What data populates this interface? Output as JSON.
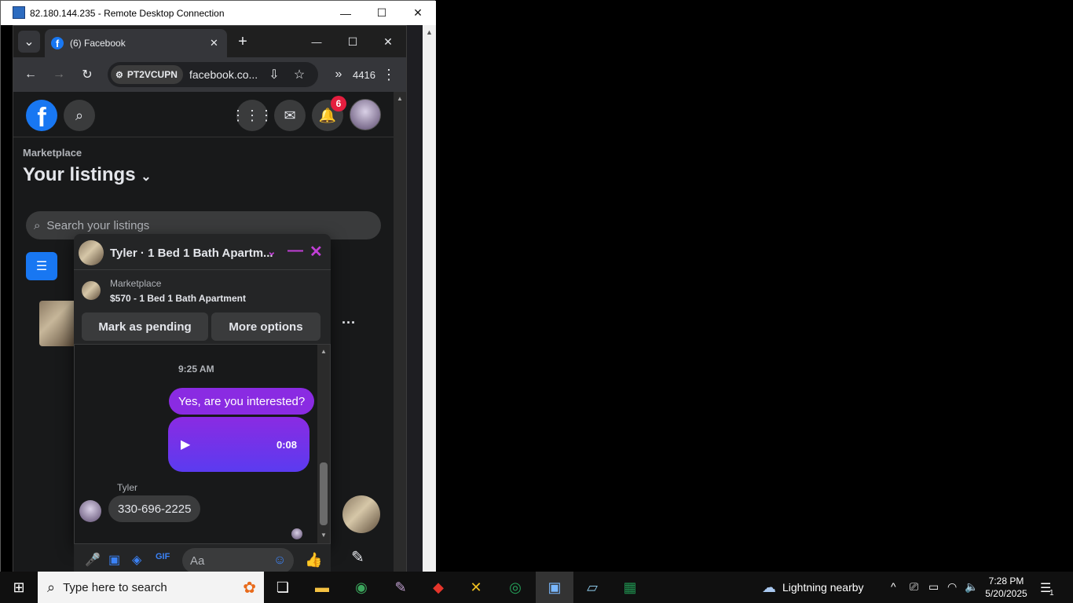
{
  "rdp": {
    "title": "82.180.144.235 - Remote Desktop Connection",
    "minimize": "—",
    "maximize": "☐",
    "close": "✕"
  },
  "chrome": {
    "tab_title": "(6) Facebook",
    "tab_close": "✕",
    "new_tab": "+",
    "site_chip": "PT2VCUPN",
    "url": "facebook.co...",
    "counter": "4416",
    "minimize": "—",
    "maximize": "☐",
    "close": "✕"
  },
  "fb": {
    "notif_count": "6",
    "marketplace": "Marketplace",
    "heading": "Your listings",
    "search_placeholder": "Search your listings",
    "listing_more": "···"
  },
  "chat": {
    "title": "Tyler · 1 Bed 1 Bath Apartm...",
    "card_label": "Marketplace",
    "card_title": "$570 - 1 Bed 1 Bath Apartment",
    "btn_pending": "Mark as pending",
    "btn_more": "More options",
    "time": "9:25 AM",
    "out_msg": "Yes, are you interested?",
    "voice_duration": "0:08",
    "sender": "Tyler",
    "in_msg": "330-696-2225",
    "input_placeholder": "Aa"
  },
  "taskbar": {
    "search_placeholder": "Type here to search",
    "weather": "Lightning nearby",
    "time": "7:28 PM",
    "date": "5/20/2025",
    "notifications": "1"
  },
  "colors": {
    "fb_blue": "#1877f2",
    "messenger_purple": "#8a2be2",
    "badge_red": "#e41e3f"
  }
}
